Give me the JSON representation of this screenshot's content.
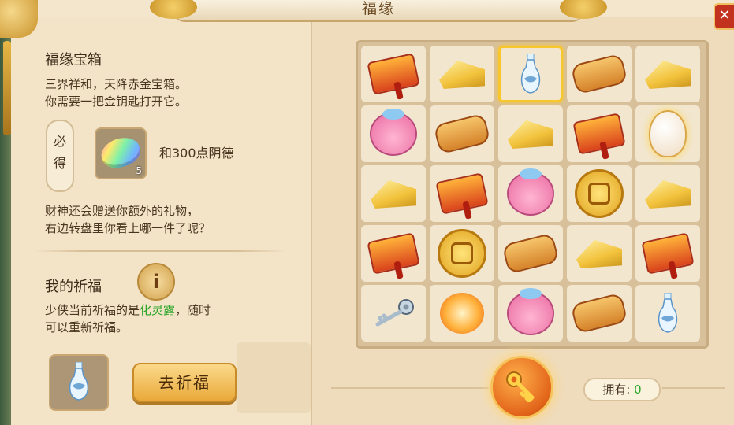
{
  "window": {
    "title": "福缘",
    "close_glyph": "✕"
  },
  "chest": {
    "title": "福缘宝箱",
    "desc_line1": "三界祥和，天降赤金宝箱。",
    "desc_line2": "你需要一把金钥匙打开它。",
    "must_get_char1": "必",
    "must_get_char2": "得",
    "reward_count": "5",
    "reward_extra": "和300点阴德",
    "gift_line1": "财神还会赠送你额外的礼物，",
    "gift_line2": "右边转盘里你看上哪一件了呢？"
  },
  "blessing": {
    "title": "我的祈福",
    "info_glyph": "i",
    "desc_prefix": "少侠当前祈福的是",
    "item_name": "化灵露",
    "desc_suffix": "，随时",
    "desc_line2": "可以重新祈福。",
    "button_label": "去祈福"
  },
  "wheel": {
    "grid": [
      [
        "hammer",
        "gold",
        "vase",
        "scroll",
        "gold"
      ],
      [
        "pig",
        "scroll",
        "gold",
        "hammer",
        "egg"
      ],
      [
        "gold",
        "hammer",
        "pig",
        "coin",
        "gold"
      ],
      [
        "hammer",
        "coin",
        "scroll",
        "gold",
        "hammer"
      ],
      [
        "key",
        "fire",
        "pig",
        "scroll",
        "vase"
      ]
    ],
    "selected_row": 0,
    "selected_col": 2,
    "owned_label": "拥有:",
    "owned_count": "0"
  },
  "colors": {
    "highlight": "#27a627",
    "selected": "#f7c72b",
    "close_button": "#c2321f"
  }
}
